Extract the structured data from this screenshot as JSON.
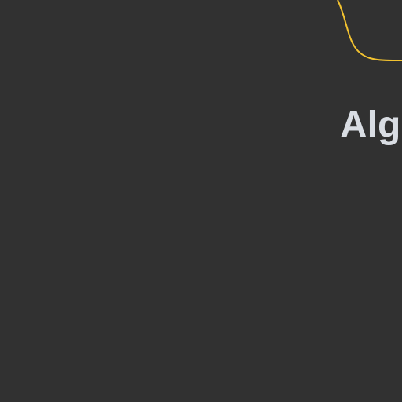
{
  "canvas": {
    "background": "#313131"
  },
  "connector": {
    "color": "#f2c230"
  },
  "node": {
    "title": "Alg",
    "title_color": "#d9dde3"
  }
}
